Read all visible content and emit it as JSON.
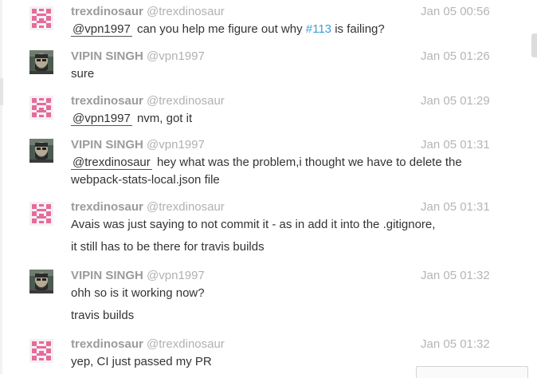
{
  "messages": [
    {
      "avatar": "pink-identicon",
      "name": "trexdinosaur",
      "handle": "@trexdinosaur",
      "time": "Jan 05 00:56",
      "lines": [
        {
          "mention": "@vpn1997",
          "text_before_issue": "can you help me figure out why",
          "issue": "#113",
          "text_after_issue": "is failing?"
        }
      ]
    },
    {
      "avatar": "bearded-man-photo",
      "name": "VIPIN SINGH",
      "handle": "@vpn1997",
      "time": "Jan 05 01:26",
      "lines": [
        {
          "text": "sure"
        }
      ]
    },
    {
      "avatar": "pink-identicon",
      "name": "trexdinosaur",
      "handle": "@trexdinosaur",
      "time": "Jan 05 01:29",
      "lines": [
        {
          "mention": "@vpn1997",
          "text": "nvm, got it"
        }
      ]
    },
    {
      "avatar": "bearded-man-photo",
      "name": "VIPIN SINGH",
      "handle": "@vpn1997",
      "time": "Jan 05 01:31",
      "lines": [
        {
          "mention": "@trexdinosaur",
          "text": "hey what was the problem,i thought we have to delete the"
        },
        {
          "text": "webpack-stats-local.json file"
        }
      ]
    },
    {
      "avatar": "pink-identicon",
      "name": "trexdinosaur",
      "handle": "@trexdinosaur",
      "time": "Jan 05 01:31",
      "lines": [
        {
          "text": "Avais was just saying to not commit it - as in add it into the .gitignore,"
        },
        {
          "text": "it still has to be there for travis builds"
        }
      ]
    },
    {
      "avatar": "bearded-man-photo",
      "name": "VIPIN SINGH",
      "handle": "@vpn1997",
      "time": "Jan 05 01:32",
      "lines": [
        {
          "text": "ohh so is it working now?"
        },
        {
          "text": "travis builds"
        }
      ]
    },
    {
      "avatar": "pink-identicon",
      "name": "trexdinosaur",
      "handle": "@trexdinosaur",
      "time": "Jan 05 01:32",
      "lines": [
        {
          "text": "yep, CI just passed my PR"
        }
      ]
    }
  ],
  "colors": {
    "identicon": "#e56b9b",
    "issue_link": "#3a9fd8",
    "name": "#9b9b9b",
    "time": "#b5b5b5"
  }
}
